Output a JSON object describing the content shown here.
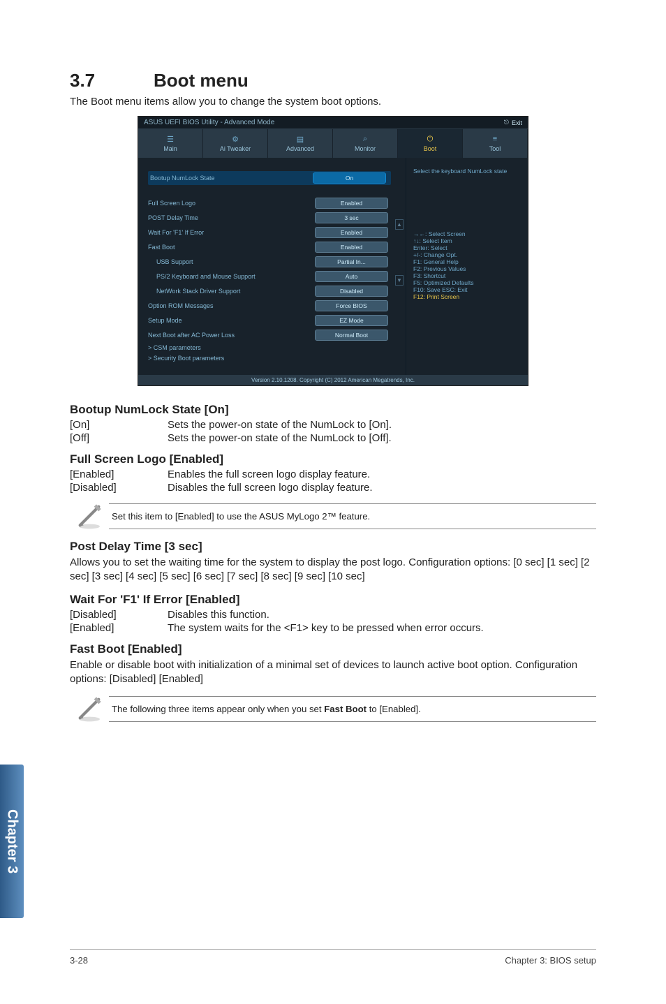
{
  "header": {
    "section_number": "3.7",
    "section_title": "Boot menu"
  },
  "lead": "The Boot menu items allow you to change the system boot options.",
  "bios": {
    "brand_text": "ASUS UEFI BIOS Utility - Advanced Mode",
    "exit_label": "Exit",
    "tabs": {
      "main": "Main",
      "ai": "Ai Tweaker",
      "advanced": "Advanced",
      "monitor": "Monitor",
      "boot": "Boot",
      "tool": "Tool"
    },
    "right_top": "Select the keyboard NumLock state",
    "rows": {
      "numlock": {
        "label": "Bootup NumLock State",
        "val": "On"
      },
      "logo": {
        "label": "Full Screen Logo",
        "val": "Enabled"
      },
      "delay": {
        "label": "POST Delay Time",
        "val": "3 sec"
      },
      "f1": {
        "label": "Wait For 'F1' If Error",
        "val": "Enabled"
      },
      "fast": {
        "label": "Fast Boot",
        "val": "Enabled"
      },
      "usb": {
        "label": "USB Support",
        "val": "Partial In..."
      },
      "ps2": {
        "label": "PS/2 Keyboard and Mouse Support",
        "val": "Auto"
      },
      "net": {
        "label": "NetWork Stack Driver Support",
        "val": "Disabled"
      },
      "rom": {
        "label": "Option ROM Messages",
        "val": "Force BIOS"
      },
      "setup": {
        "label": "Setup Mode",
        "val": "EZ Mode"
      },
      "acloss": {
        "label": "Next Boot after AC Power Loss",
        "val": "Normal Boot"
      },
      "csm": "> CSM parameters",
      "sec": "> Security Boot parameters"
    },
    "keys": {
      "k1": "→←: Select Screen",
      "k2": "↑↓: Select Item",
      "k3": "Enter: Select",
      "k4": "+/-: Change Opt.",
      "k5": "F1: General Help",
      "k6": "F2: Previous Values",
      "k7": "F3: Shortcut",
      "k8": "F5: Optimized Defaults",
      "k9": "F10: Save  ESC: Exit",
      "k10": "F12: Print Screen"
    },
    "bottom": "Version 2.10.1208. Copyright (C) 2012 American Megatrends, Inc."
  },
  "sections": {
    "numlock": {
      "title": "Bootup NumLock State [On]",
      "opt1_k": "[On]",
      "opt1_v": "Sets the power-on state of the NumLock to [On].",
      "opt2_k": "[Off]",
      "opt2_v": "Sets the power-on state of the NumLock to [Off]."
    },
    "logo": {
      "title": "Full Screen Logo [Enabled]",
      "opt1_k": "[Enabled]",
      "opt1_v": "Enables the full screen logo display feature.",
      "opt2_k": "[Disabled]",
      "opt2_v": "Disables the full screen logo display feature.",
      "note": "Set this item to [Enabled] to use the ASUS MyLogo 2™ feature."
    },
    "delay": {
      "title": "Post Delay Time [3 sec]",
      "body": "Allows you to set the waiting time for the system to display the post logo. Configuration options: [0 sec] [1 sec] [2 sec] [3 sec] [4 sec] [5 sec] [6 sec] [7 sec] [8 sec] [9 sec] [10 sec]"
    },
    "f1": {
      "title": "Wait For 'F1' If Error [Enabled]",
      "opt1_k": "[Disabled]",
      "opt1_v": "Disables this function.",
      "opt2_k": "[Enabled]",
      "opt2_v": "The system waits for the <F1> key to be pressed when error occurs."
    },
    "fast": {
      "title": "Fast Boot [Enabled]",
      "body": "Enable or disable boot with initialization of a minimal set of devices to launch active boot option. Configuration options: [Disabled] [Enabled]",
      "note_prefix": "The following three items appear only when you set ",
      "note_bold": "Fast Boot",
      "note_suffix": " to [Enabled]."
    }
  },
  "sidebar": "Chapter 3",
  "footer": {
    "left": "3-28",
    "right": "Chapter 3: BIOS setup"
  }
}
